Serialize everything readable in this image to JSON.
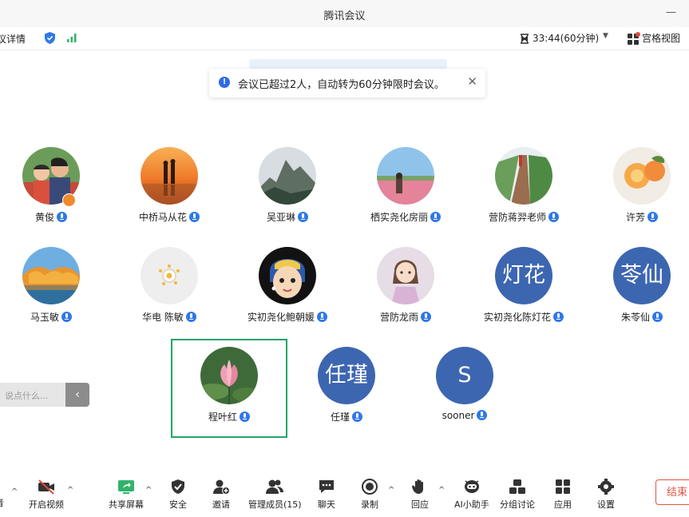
{
  "window": {
    "title": "腾讯会议"
  },
  "infobar": {
    "meeting_details": "议详情",
    "timer": "33:44(60分钟)",
    "view_mode": "宫格视图"
  },
  "notice": {
    "text": "会议已超过2人，自动转为60分钟限时会议。",
    "icon": "info-icon",
    "close_icon": "close-icon"
  },
  "participants": [
    {
      "name": "黄俊"
    },
    {
      "name": "中桥马从花"
    },
    {
      "name": "吴亚琳"
    },
    {
      "name": "栖实尧化房丽"
    },
    {
      "name": "营防蒋羿老师"
    },
    {
      "name": "许芳"
    },
    {
      "name": "马玉敏"
    },
    {
      "name": "华电 陈敏"
    },
    {
      "name": "实初尧化鲍朝媛"
    },
    {
      "name": "营防龙雨"
    },
    {
      "name": "实初尧化陈灯花",
      "initials": "灯花"
    },
    {
      "name": "朱苓仙",
      "initials": "苓仙"
    },
    {
      "name": "程叶红"
    },
    {
      "name": "任瑾",
      "initials": "任瑾"
    },
    {
      "name": "sooner",
      "initials": "S"
    }
  ],
  "chat": {
    "placeholder": "说点什么..."
  },
  "toolbar": {
    "cut_label": "音",
    "video": "开启视频",
    "share": "共享屏幕",
    "security": "安全",
    "invite": "邀请",
    "members": "管理成员(15)",
    "chat": "聊天",
    "record": "录制",
    "reactions": "回应",
    "ai": "AI小助手",
    "breakout": "分组讨论",
    "apps": "应用",
    "settings": "设置",
    "end": "结束"
  },
  "colors": {
    "accent": "#2f78e8",
    "avatar_bg": "#3d66b1",
    "speaker_border": "#23a46a",
    "end": "#e05543"
  }
}
